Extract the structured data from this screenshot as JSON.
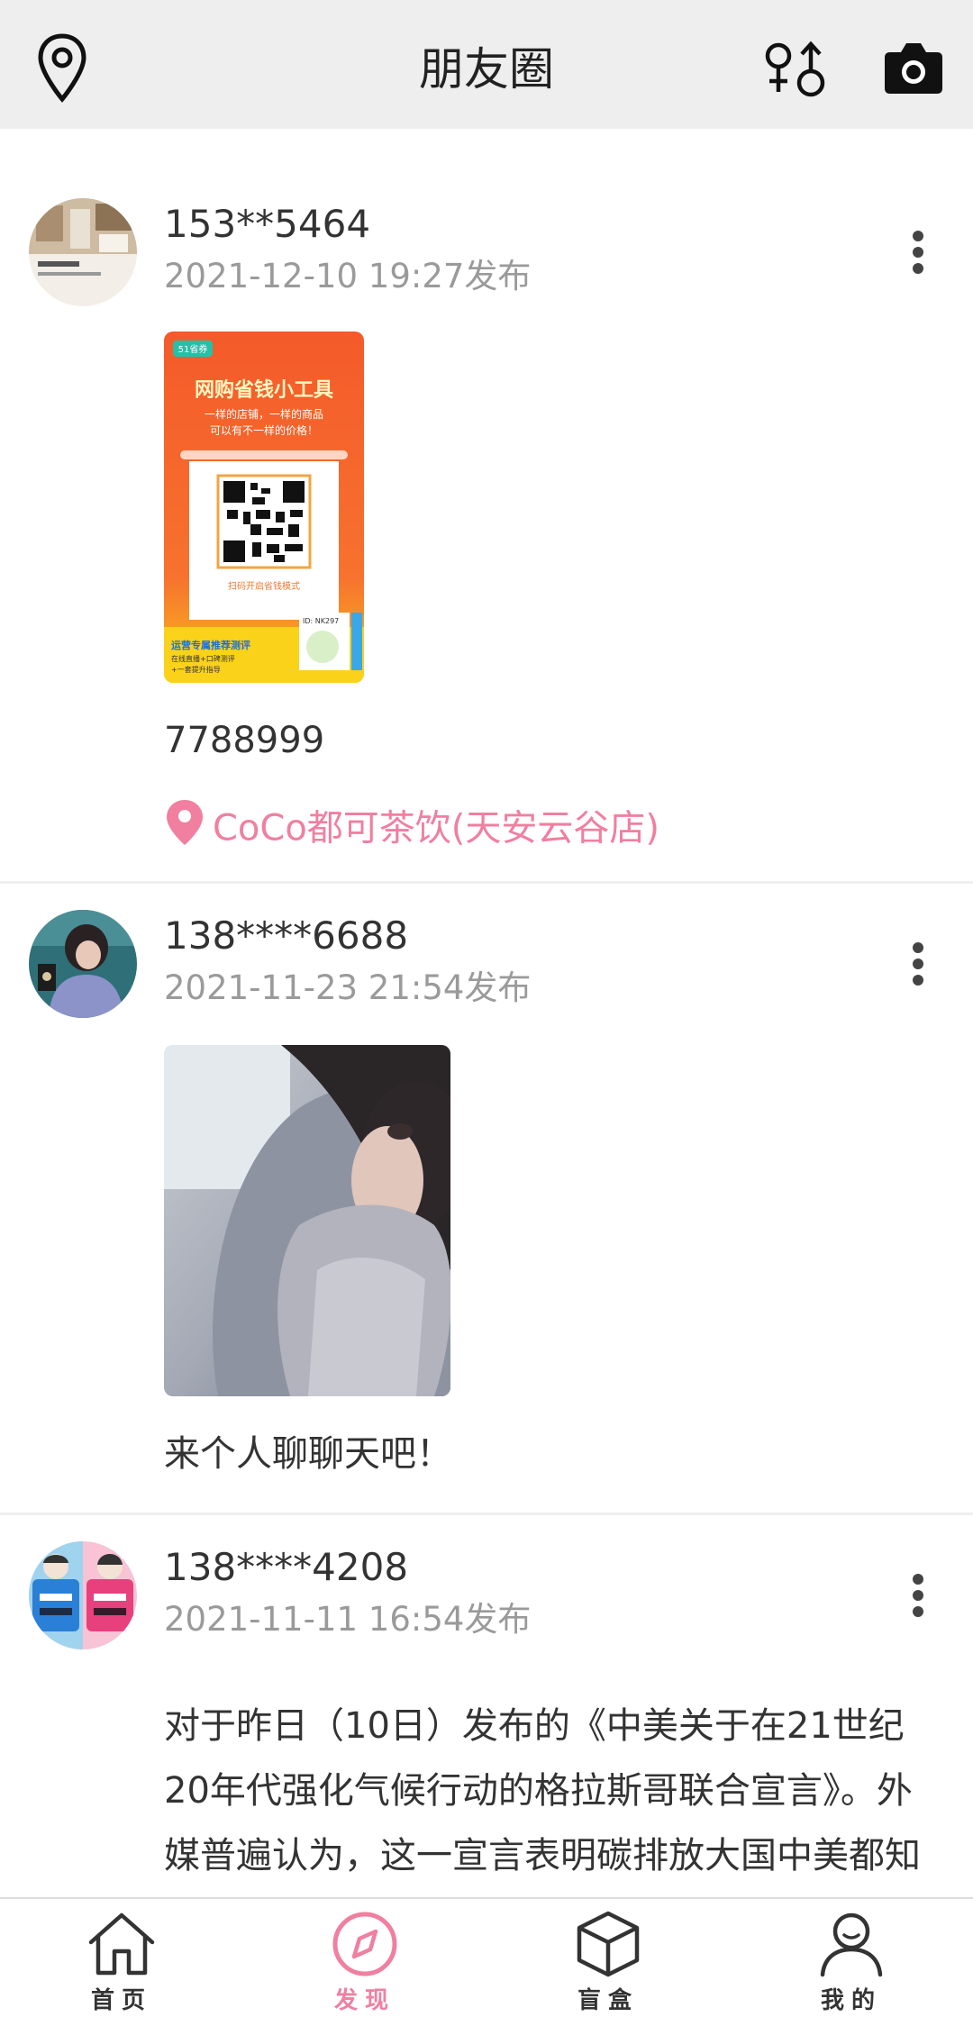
{
  "header": {
    "title": "朋友圈",
    "icons": [
      "location-pin-icon",
      "gender-filter-icon",
      "camera-icon"
    ]
  },
  "posts": [
    {
      "username": "153**5464",
      "time": "2021-12-10 19:27发布",
      "content": "7788999",
      "location": "CoCo都可茶饮(天安云谷店)",
      "image": {
        "tag": "51省券",
        "headline": "网购省钱小工具",
        "sub1": "一样的店铺，一样的商品",
        "sub2": "可以有不一样的价格！",
        "scan_text": "扫码开启省钱模式",
        "id_text": "ID: NK297",
        "bottom1": "运营专属推荐测评",
        "bottom2": "在线直播+口碑测评",
        "bottom3": "+一套提升指导"
      }
    },
    {
      "username": "138****6688",
      "time": "2021-11-23 21:54发布",
      "content": "来个人聊聊天吧！"
    },
    {
      "username": "138****4208",
      "time": "2021-11-11 16:54发布",
      "content_lines": [
        "对于昨日（10日）发布的《中美关于在21世纪",
        "20年代强化气候行动的格拉斯哥联合宣言》。外",
        "媒普遍认为，这一宣言表明碳排放大国中美都知"
      ]
    }
  ],
  "tabbar": {
    "items": [
      {
        "label": "首页",
        "icon": "home-icon"
      },
      {
        "label": "发现",
        "icon": "compass-icon"
      },
      {
        "label": "盲盒",
        "icon": "box-icon"
      },
      {
        "label": "我的",
        "icon": "user-icon"
      }
    ],
    "active": "发现"
  },
  "colors": {
    "accent": "#f07fa0",
    "header_bg": "#eeeeee",
    "time_gray": "#9a9a9a"
  }
}
